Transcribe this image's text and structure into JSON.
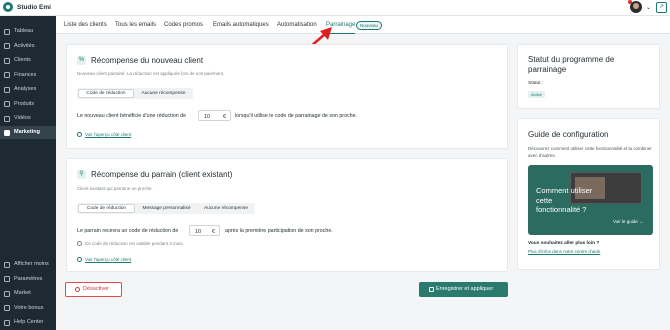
{
  "app": {
    "name": "Studio Emi"
  },
  "sidebar": {
    "items": [
      {
        "label": "Tableau",
        "icon": "dashboard-icon"
      },
      {
        "label": "Activités",
        "icon": "activity-icon"
      },
      {
        "label": "Clients",
        "icon": "users-icon"
      },
      {
        "label": "Finances",
        "icon": "finance-icon"
      },
      {
        "label": "Analyses",
        "icon": "chart-icon"
      },
      {
        "label": "Produits",
        "icon": "box-icon"
      },
      {
        "label": "Vidéos",
        "icon": "video-icon"
      },
      {
        "label": "Marketing",
        "icon": "megaphone-icon"
      },
      {
        "label": "Afficher moins",
        "icon": "collapse-icon"
      },
      {
        "label": "Paramètres",
        "icon": "gear-icon"
      },
      {
        "label": "Market",
        "icon": "store-icon"
      },
      {
        "label": "Votre bonus",
        "icon": "heart-icon"
      },
      {
        "label": "Help Center",
        "icon": "help-icon"
      }
    ],
    "active_index": 7
  },
  "tabs": {
    "items": [
      "Liste des clients",
      "Tous les emails",
      "Codes promos",
      "Emails automatiques",
      "Automatisation",
      "Parrainage"
    ],
    "active": "Parrainage",
    "badge": "Nouveau"
  },
  "new_client": {
    "title": "Récompense du nouveau client",
    "subtitle": "Nouveau client parrainé. La réduction est appliquée lors de son paiement.",
    "segments": [
      "Code de réduction",
      "Aucune récompense"
    ],
    "selected": "Code de réduction",
    "text_before": "Le nouveau client bénéficie d'une réduction de",
    "value": "10",
    "unit": "€",
    "text_after": "lorsqu'il utilise le code de parrainage de son proche.",
    "preview_link": "Voir l'aperçu côté client"
  },
  "referrer": {
    "title": "Récompense du parrain (client existant)",
    "subtitle": "Client existant qui parraine un proche.",
    "segments": [
      "Code de réduction",
      "Message personnalisé",
      "Aucune récompense"
    ],
    "selected": "Code de réduction",
    "text_before": "Le parrain recevra un code de réduction de",
    "value": "10",
    "unit": "€",
    "text_after": "après la première participation de son proche.",
    "validity_note": "Ce code de réduction est valable pendant 3 mois.",
    "preview_link": "Voir l'aperçu côté client"
  },
  "actions": {
    "deactivate": "Désactiver",
    "save": "Enregistrer et appliquer"
  },
  "program_status": {
    "title": "Statut du programme de parrainage",
    "label": "Statut :",
    "badge": "Activé"
  },
  "guide": {
    "title": "Guide de configuration",
    "description": "Découvrez comment utiliser cette fonctionnalité et la combiner avec d'autres.",
    "video_text": "Comment utiliser cette fonctionnalité ?",
    "video_link": "Voir le guide →",
    "question": "Vous souhaitez aller plus loin ?",
    "help_link": "Plus d'infos dans notre centre d'aide"
  },
  "colors": {
    "accent": "#1d7a6e",
    "sidebar": "#1e2a33",
    "danger": "#e04a4a",
    "annotation_arrow": "#e02020"
  }
}
